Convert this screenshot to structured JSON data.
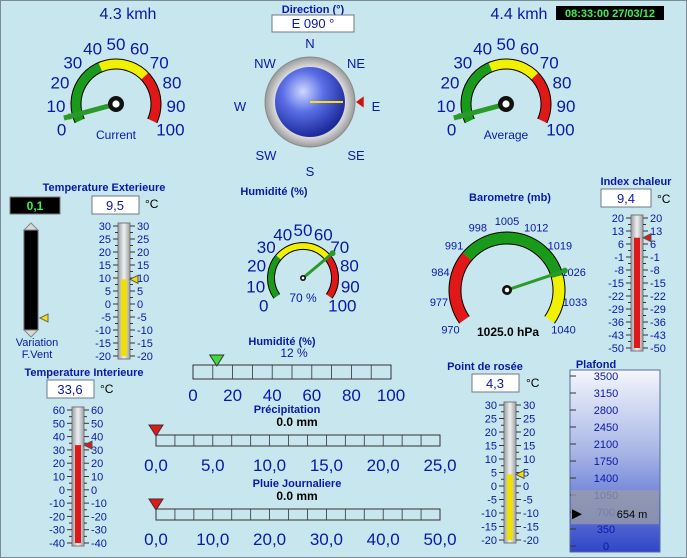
{
  "wind_current": {
    "speed": "4.3 kmh",
    "caption": "Current",
    "value": 4.3,
    "scale": [
      "0",
      "10",
      "20",
      "30",
      "40",
      "50",
      "60",
      "70",
      "80",
      "90",
      "100"
    ]
  },
  "wind_average": {
    "speed": "4.4 kmh",
    "caption": "Average",
    "value": 4.4,
    "scale": [
      "0",
      "10",
      "20",
      "30",
      "40",
      "50",
      "60",
      "70",
      "80",
      "90",
      "100"
    ]
  },
  "clock": "08:33:00 27/03/12",
  "direction": {
    "title": "Direction (°)",
    "value": "E  090 °",
    "degrees": 90,
    "labels": [
      "N",
      "NE",
      "E",
      "SE",
      "S",
      "SW",
      "W",
      "NW"
    ]
  },
  "temp_ext": {
    "title": "Temperature Exterieure",
    "value": "9,5",
    "unit": "°C",
    "numeric": 9.5,
    "variation": "0,1",
    "variation_caption": "Variation",
    "fvent_caption": "F.Vent",
    "scale": [
      "30",
      "25",
      "20",
      "15",
      "10",
      "5",
      "0",
      "-5",
      "-10",
      "-15",
      "-20"
    ]
  },
  "humidity": {
    "title": "Humidité (%)",
    "value": "70 %",
    "numeric": 70,
    "scale": [
      "0",
      "10",
      "20",
      "30",
      "40",
      "50",
      "60",
      "70",
      "80",
      "90",
      "100"
    ]
  },
  "humidity_bar": {
    "title": "Humidité (%)",
    "value": "12 %",
    "numeric": 12,
    "scale": [
      "0",
      "20",
      "40",
      "60",
      "80",
      "100"
    ]
  },
  "barometer": {
    "title": "Barometre (mb)",
    "value": "1025.0 hPa",
    "numeric": 1025.0,
    "scale": [
      "970",
      "977",
      "984",
      "991",
      "998",
      "1005",
      "1012",
      "1019",
      "1026",
      "1033",
      "1040"
    ]
  },
  "heat_index": {
    "title": "Index chaleur",
    "value": "9,4",
    "unit": "°C",
    "numeric": 9.4,
    "scale_left": [
      "20",
      "13",
      "6",
      "-1",
      "-8",
      "-15",
      "-22",
      "-29",
      "-36",
      "-43",
      "-50"
    ],
    "scale_right": [
      "20",
      "13",
      "6",
      "-1",
      "-8",
      "-15",
      "-22",
      "-29",
      "-36",
      "-43",
      "-50"
    ]
  },
  "temp_int": {
    "title": "Temperature Interieure",
    "value": "33,6",
    "unit": "°C",
    "numeric": 33.6,
    "scale": [
      "60",
      "50",
      "40",
      "30",
      "20",
      "10",
      "0",
      "-10",
      "-20",
      "-30",
      "-40"
    ]
  },
  "precipitation": {
    "title": "Précipitation",
    "value": "0.0 mm",
    "numeric": 0.0,
    "scale": [
      "0,0",
      "5,0",
      "10,0",
      "15,0",
      "20,0",
      "25,0"
    ]
  },
  "daily_rain": {
    "title": "Pluie Journaliere",
    "value": "0.0 mm",
    "numeric": 0.0,
    "scale": [
      "0,0",
      "10,0",
      "20,0",
      "30,0",
      "40,0",
      "50,0"
    ]
  },
  "dew_point": {
    "title": "Point de rosée",
    "value": "4,3",
    "unit": "°C",
    "numeric": 4.3,
    "scale": [
      "30",
      "25",
      "20",
      "15",
      "10",
      "5",
      "0",
      "-5",
      "-10",
      "-15",
      "-20"
    ]
  },
  "ceiling": {
    "title": "Plafond",
    "value": "654 m",
    "numeric": 654,
    "scale": [
      "3500",
      "3150",
      "2800",
      "2450",
      "2100",
      "1750",
      "1400",
      "1050",
      "700",
      "350",
      "0"
    ]
  }
}
